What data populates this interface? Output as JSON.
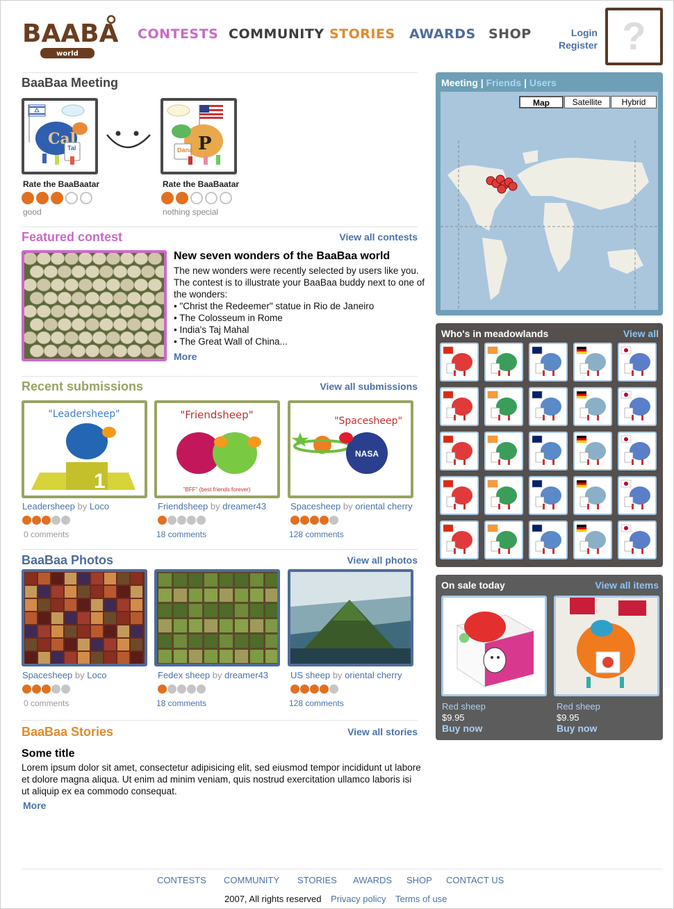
{
  "header": {
    "logo_main": "BAABAA",
    "logo_sub": "world",
    "nav": [
      {
        "label": "CONTESTS",
        "color": "#c96ac8"
      },
      {
        "label": "COMMUNITY",
        "color": "#3d3d3d"
      },
      {
        "label": "STORIES",
        "color": "#e08a2c"
      },
      {
        "label": "AWARDS",
        "color": "#4e6c9a"
      },
      {
        "label": "SHOP",
        "color": "#555555"
      }
    ],
    "login": "Login",
    "register": "Register",
    "avatar_placeholder": "?"
  },
  "meeting": {
    "title": "BaaBaa Meeting",
    "left": {
      "rate_label": "Rate the BaaBaatar",
      "rating": 3,
      "rating_text": "good",
      "badge_name": "Tal"
    },
    "right": {
      "rate_label": "Rate the BaaBaatar",
      "rating": 2,
      "rating_text": "nothing special",
      "badge_name": "Dana"
    }
  },
  "featured": {
    "title": "Featured contest",
    "view_all": "View all contests",
    "heading": "New seven wonders of the BaaBaa world",
    "text": "The new wonders were recently selected by users like you. The contest is to illustrate your BaaBaa buddy next to one of the wonders:",
    "bullets": [
      "\"Christ the Redeemer\" statue in Rio de Janeiro",
      "The Colosseum in Rome",
      "India's Taj Mahal",
      "The Great Wall of China..."
    ],
    "more": "More"
  },
  "submissions": {
    "title": "Recent submissions",
    "view_all": "View all submissions",
    "items": [
      {
        "image_title": "\"Leadersheep\"",
        "name": "Leadersheep",
        "by": "by",
        "author": "Loco",
        "rating": 3,
        "comments": "0 comments"
      },
      {
        "image_title": "\"Friendsheep\"",
        "image_caption": "\"BFF\" (best friends forever)",
        "name": "Friendsheep",
        "by": "by",
        "author": "dreamer43",
        "rating": 1,
        "comments": "18 comments"
      },
      {
        "image_title": "\"Spacesheep\"",
        "badge": "NASA",
        "name": "Spacesheep",
        "by": "by",
        "author": "oriental cherry",
        "rating": 4,
        "comments": "128 comments"
      }
    ]
  },
  "photos": {
    "title": "BaaBaa Photos",
    "view_all": "View all photos",
    "items": [
      {
        "name": "Spacesheep",
        "by": "by",
        "author": "Loco",
        "rating": 3,
        "comments": "0 comments"
      },
      {
        "name": "Fedex sheep",
        "by": "by",
        "author": "dreamer43",
        "rating": 1,
        "comments": "18 comments"
      },
      {
        "name": "US sheep",
        "by": "by",
        "author": "oriental cherry",
        "rating": 4,
        "comments": "128 comments"
      }
    ]
  },
  "stories": {
    "title": "BaaBaa Stories",
    "view_all": "View all stories",
    "heading": "Some title",
    "text": "Lorem ipsum dolor sit amet, consectetur adipisicing elit, sed eiusmod tempor incididunt ut labore et dolore magna aliqua. Ut enim ad minim veniam, quis nostrud exercitation ullamco laboris isi ut aliquip ex ea commodo consequat.",
    "more": "More"
  },
  "map_panel": {
    "tab_meeting": "Meeting",
    "sep": "|",
    "tab_friends": "Friends",
    "tab_users": "Users",
    "map_types": [
      "Map",
      "Satellite",
      "Hybrid"
    ],
    "selected_type": "Map"
  },
  "who": {
    "title": "Who's in meadowlands",
    "view_all": "View all",
    "flags": [
      "china",
      "india",
      "australia",
      "germany",
      "japan"
    ],
    "rows": 5
  },
  "sale": {
    "title": "On sale today",
    "view_all": "View all items",
    "items": [
      {
        "name": "Red sheep",
        "price": "$9.95",
        "buy": "Buy now"
      },
      {
        "name": "Red sheep",
        "price": "$9.95",
        "buy": "Buy now"
      }
    ]
  },
  "footer": {
    "nav": [
      "CONTESTS",
      "COMMUNITY",
      "STORIES",
      "AWARDS",
      "SHOP",
      "CONTACT US"
    ],
    "copyright": "2007, All rights reserved",
    "privacy": "Privacy policy",
    "terms": "Terms of use"
  },
  "colors": {
    "brown": "#6b3d1f",
    "link": "#4a72a8",
    "featured": "#c96ac8",
    "submissions": "#9aa363",
    "photos": "#4e6c9a",
    "stories": "#e08a2c",
    "rating_on": "#e1701f",
    "rating_off": "#c5c5c5"
  }
}
